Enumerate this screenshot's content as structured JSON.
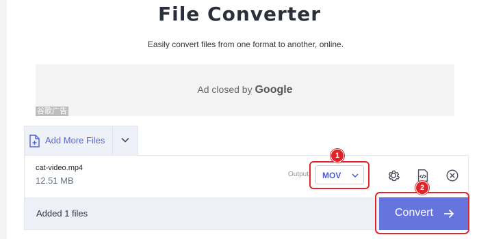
{
  "header": {
    "title": "File Converter",
    "subtitle": "Easily convert files from one format to another, online."
  },
  "ad": {
    "text_prefix": "Ad closed by",
    "text_brand": "Google",
    "tag": "谷歌广告"
  },
  "add_files": {
    "label": "Add More Files",
    "icon": "file-plus-icon",
    "dropdown_icon": "chevron-down-icon"
  },
  "file": {
    "name": "cat-video.mp4",
    "size": "12.51 MB",
    "output_label": "Output:",
    "output_value": "MOV",
    "actions": [
      "gear-icon",
      "code-icon",
      "close-circle-icon"
    ]
  },
  "footer": {
    "status": "Added 1 files",
    "convert_label": "Convert",
    "convert_icon": "arrow-right-icon"
  },
  "annotations": {
    "step1": "1",
    "step2": "2"
  },
  "colors": {
    "accent": "#6675dd",
    "link": "#5566d6",
    "annotation": "#e0242a",
    "panel": "#edf0f6"
  }
}
